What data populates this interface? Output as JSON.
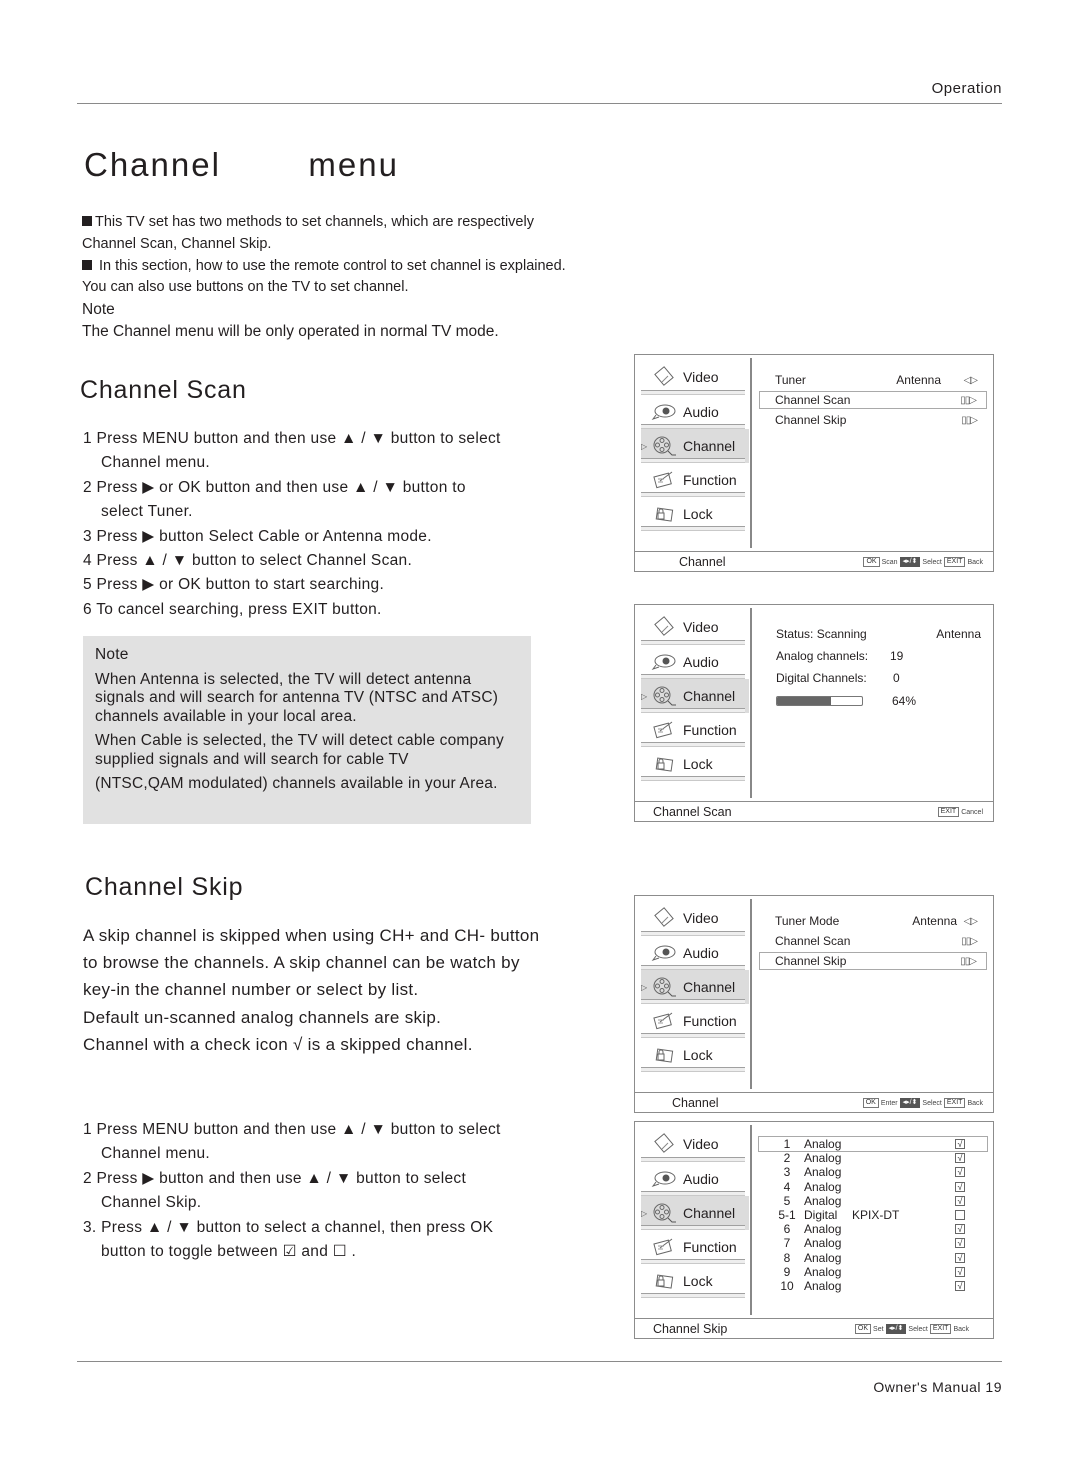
{
  "header": {
    "section": "Operation"
  },
  "footer": {
    "label": "Owner's Manual 19"
  },
  "page_title": "Channel   menu",
  "intro": {
    "bullet1": "This TV set has two methods to set channels, which are respectively Channel Scan,  Channel Skip.",
    "bullet2": " In this section, how to use the remote control  to set channel is explained. You can also use buttons on the TV  to set channel.",
    "note_label": "Note",
    "note_text": "The Channel menu will be only operated  in normal TV mode."
  },
  "channel_scan": {
    "heading": "Channel Scan",
    "steps": [
      "1  Press MENU button and then use ▲ / ▼ button to select",
      "Channel  menu.",
      "2  Press ▶ or OK button and then use ▲ / ▼ button to",
      "select Tuner.",
      "3  Press ▶ button  Select Cable or Antenna   mode.",
      "4 Press ▲ / ▼ button to select  Channel Scan.",
      "5 Press ▶  or OK  button to start searching.",
      "6 To cancel searching, press EXIT button."
    ],
    "note": {
      "title": "Note",
      "p1": "When Antenna   is selected, the TV will detect antenna signals and will search for antenna TV (NTSC and ATSC) channels available in your local area.",
      "p2a": "When Cable is selected, the TV will detect cable company supplied signals and will search for cable TV",
      "p2b": "(NTSC,QAM modulated) channels available in your Area."
    }
  },
  "channel_skip": {
    "heading": "Channel Skip",
    "para1": "A skip channel is skipped when using CH+ and CH- button to browse the channels. A skip channel can be watch by key-in the channel number or select by list.",
    "para2": "Default un-scanned analog channels are skip.",
    "para3": "Channel with a check icon √ is a skipped channel.",
    "steps": [
      "1  Press MENU button and then use ▲ / ▼ button to select",
      "Channel  menu.",
      "2  Press ▶ button and then use ▲ / ▼ button to select",
      "Channel Skip.",
      "3. Press ▲ / ▼ button to select a channel, then press OK",
      "button to  toggle between ☑  and ☐ ."
    ]
  },
  "osd_menu": [
    "Video",
    "Audio",
    "Channel",
    "Function",
    "Lock"
  ],
  "osd_selected": "Channel",
  "keys": {
    "ok": "OK",
    "nav": "◂▸/⬍",
    "exit": "EXIT",
    "select": "Select",
    "back": "Back",
    "scan": "Scan",
    "enter": "Enter",
    "set": "Set",
    "cancel": "Cancel"
  },
  "osd1": {
    "title": "Channel",
    "rows": [
      {
        "label": "Tuner",
        "value": "Antenna",
        "arrow": "◁▷"
      },
      {
        "label": "Channel Scan",
        "value": "",
        "arrow": "▯▯▷"
      },
      {
        "label": "Channel Skip",
        "value": "",
        "arrow": "▯▯▷"
      }
    ]
  },
  "osd2": {
    "title": "Channel Scan",
    "status_label": "Status: Scanning",
    "source": "Antenna",
    "analog_label": "Analog channels:",
    "analog_value": "19",
    "digital_label": "Digital Channels:",
    "digital_value": "0",
    "progress_percent": 64,
    "progress_text": "64%"
  },
  "osd3": {
    "title": "Channel",
    "rows": [
      {
        "label": "Tuner Mode",
        "value": "Antenna",
        "arrow": "◁▷"
      },
      {
        "label": "Channel Scan",
        "value": "",
        "arrow": "▯▯▷"
      },
      {
        "label": "Channel Skip",
        "value": "",
        "arrow": "▯▯▷"
      }
    ]
  },
  "osd4": {
    "title": "Channel Skip",
    "channels": [
      {
        "num": "1",
        "type": "Analog",
        "name": "",
        "skip": true
      },
      {
        "num": "2",
        "type": "Analog",
        "name": "",
        "skip": true
      },
      {
        "num": "3",
        "type": "Analog",
        "name": "",
        "skip": true
      },
      {
        "num": "4",
        "type": "Analog",
        "name": "",
        "skip": true
      },
      {
        "num": "5",
        "type": "Analog",
        "name": "",
        "skip": true
      },
      {
        "num": "5-1",
        "type": "Digital",
        "name": "KPIX-DT",
        "skip": false
      },
      {
        "num": "6",
        "type": "Analog",
        "name": "",
        "skip": true
      },
      {
        "num": "7",
        "type": "Analog",
        "name": "",
        "skip": true
      },
      {
        "num": "8",
        "type": "Analog",
        "name": "",
        "skip": true
      },
      {
        "num": "9",
        "type": "Analog",
        "name": "",
        "skip": true
      },
      {
        "num": "10",
        "type": "Analog",
        "name": "",
        "skip": true
      }
    ]
  }
}
